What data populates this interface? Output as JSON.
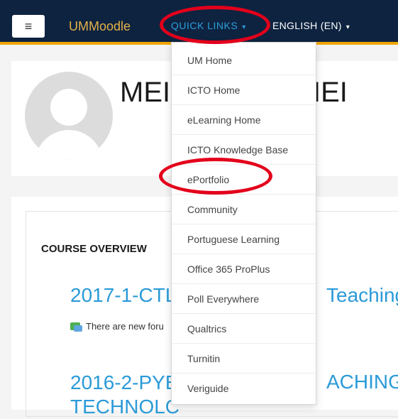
{
  "navbar": {
    "menu_icon": "hamburger-icon",
    "brand": "UMMoodle",
    "quick_links": "QUICK LINKS",
    "quick_links_caret": "▾",
    "language": "ENGLISH (EN)",
    "language_caret": "▾"
  },
  "profile": {
    "avatar_icon": "default-user-avatar",
    "name_left": "MEI",
    "name_right": "IEI"
  },
  "overview": {
    "title": "COURSE OVERVIEW",
    "course1_left": "2017-1-CTL",
    "course1_right": "Teaching",
    "notice": "There are new foru",
    "notice_icon": "forum-post-icon",
    "course2_line1": "2016-2-PYE",
    "course2_line2": "TECHNOLC",
    "course2_right": "ACHING"
  },
  "dropdown": {
    "items": [
      "UM Home",
      "ICTO Home",
      "eLearning Home",
      "ICTO Knowledge Base",
      "ePortfolio",
      "Community",
      "Portuguese Learning",
      "Office 365 ProPlus",
      "Poll Everywhere",
      "Qualtrics",
      "Turnitin",
      "Veriguide"
    ]
  },
  "colors": {
    "navbar": "#0e2340",
    "navbar_accent": "#f0a500",
    "brand": "#e3b148",
    "link": "#2b9ad8",
    "highlight_circle": "#e3001b"
  }
}
